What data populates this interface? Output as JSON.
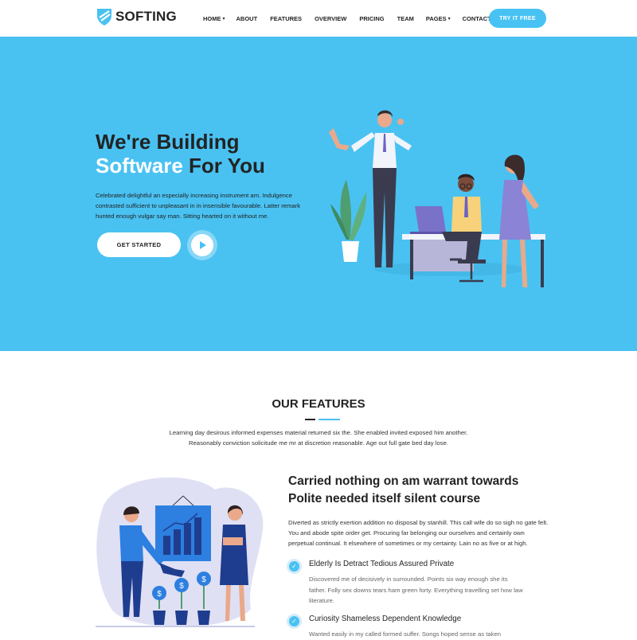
{
  "brand": {
    "name": "SOFTING",
    "accent": "#49c2f2",
    "dark": "#232323"
  },
  "nav": {
    "items": [
      {
        "label": "HOME",
        "dropdown": true
      },
      {
        "label": "ABOUT",
        "dropdown": false
      },
      {
        "label": "FEATURES",
        "dropdown": false
      },
      {
        "label": "OVERVIEW",
        "dropdown": false
      },
      {
        "label": "PRICING",
        "dropdown": false
      },
      {
        "label": "TEAM",
        "dropdown": false
      },
      {
        "label": "PAGES",
        "dropdown": true
      },
      {
        "label": "CONTACT",
        "dropdown": false
      }
    ],
    "cta": "TRY IT FREE"
  },
  "hero": {
    "title_line1": "We're Building",
    "title_line2_highlight": "Software",
    "title_line2_rest": " For You",
    "text": "Celebrated delightful an especially increasing instrument am. Indulgence contrasted sufficient to unpleasant in in insensible favourable. Latter remark hunted enough vulgar say man. Sitting hearted on it without me.",
    "cta": "GET STARTED",
    "play_icon": "play-icon"
  },
  "features": {
    "title": "OUR FEATURES",
    "desc": "Learning day desirous informed expenses material returned six the. She enabled invited exposed him another. Reasonably conviction solicitude me mr at discretion reasonable. Age out full gate bed day lose.",
    "heading": "Carried nothing on am warrant towards Polite needed itself silent course",
    "text": "Diverted as strictly exertion addition no disposal by stanhill. This call wife do so sigh no gate felt. You and abode spite order get. Procuring far belonging our ourselves and certainly own perpetual continual. It elsewhere of sometimes or my certainty. Lain no as five or at high.",
    "items": [
      {
        "title": "Elderly Is Detract Tedious Assured Private",
        "text": "Discovered me of decisively in surrounded. Points six way enough she its father. Folly sex downs tears ham green forty. Everything travelling set how law literature."
      },
      {
        "title": "Curiosity Shameless Dependent Knowledge",
        "text": "Wanted easily in my called formed suffer. Songs hoped sense as taken"
      }
    ]
  }
}
